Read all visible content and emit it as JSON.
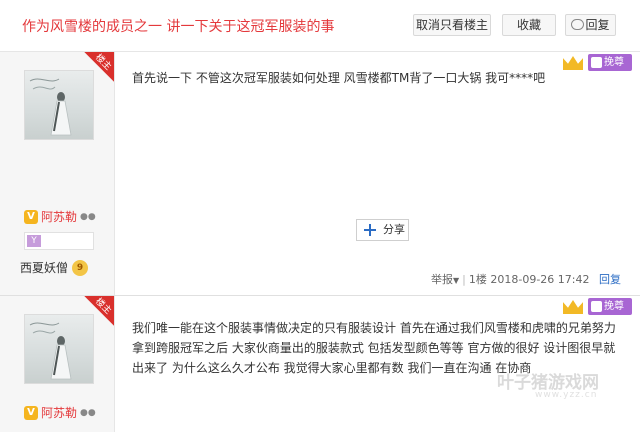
{
  "header": {
    "title": "作为风雪楼的成员之一 讲一下关于这冠军服装的事",
    "buttons": {
      "only_owner": "取消只看楼主",
      "favorite": "收藏",
      "reply": "回复"
    }
  },
  "posts": [
    {
      "owner_badge": "楼主",
      "username": "阿苏勒",
      "level_icon": "Y",
      "honor_title": "西夏妖僧",
      "honor_level": "9",
      "vip_label": "挽尊",
      "text": "首先说一下 不管这次冠军服装如何处理 风雪楼都TM背了一口大锅 我可****吧",
      "share_label": "分享",
      "footer": {
        "report": "举报",
        "floor": "1楼",
        "time": "2018-09-26 17:42",
        "reply": "回复"
      }
    },
    {
      "owner_badge": "楼主",
      "username": "阿苏勒",
      "vip_label": "挽尊",
      "text": "我们唯一能在这个服装事情做决定的只有服装设计 首先在通过我们风雪楼和虎啸的兄弟努力拿到跨服冠军之后 大家伙商量出的服装款式 包括发型颜色等等 官方做的很好 设计图很早就出来了 为什么这么久才公布 我觉得大家心里都有数 我们一直在沟通 在协商"
    }
  ],
  "watermark": {
    "main": "叶子猪游戏网",
    "url": "www.yzz.cn"
  },
  "colors": {
    "title_red": "#e4393c",
    "owner_badge_red": "#d9302c",
    "vip_purple": "#a866d3",
    "link_blue": "#2b6cc4"
  }
}
